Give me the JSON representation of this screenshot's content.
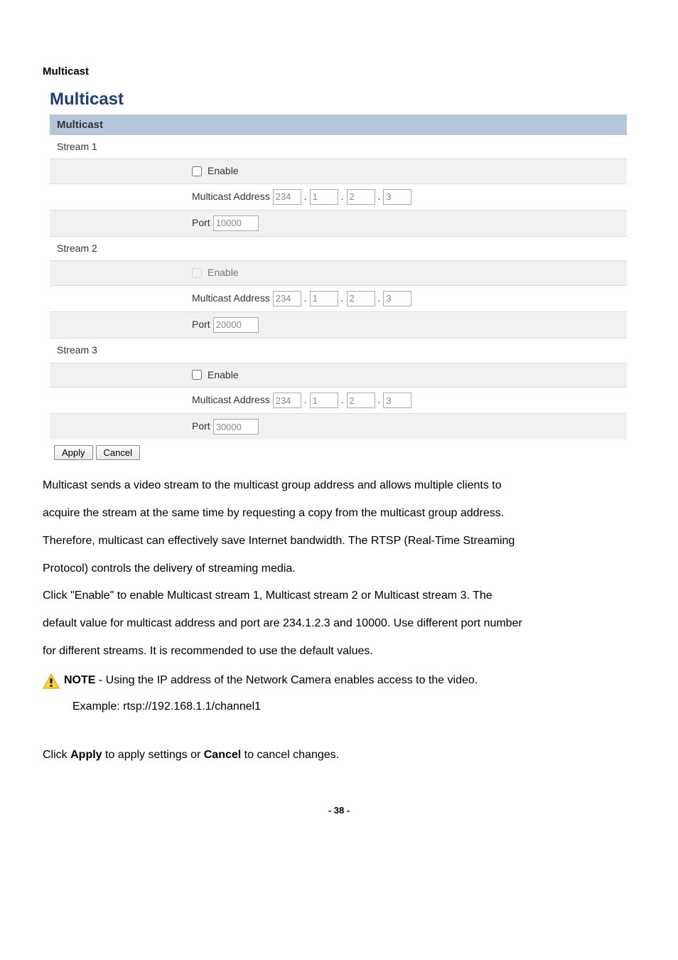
{
  "section_heading": "Multicast",
  "page_title": "Multicast",
  "panel_header": "Multicast",
  "streams": [
    {
      "label": "Stream 1",
      "enable_label": "Enable",
      "enable_checked": false,
      "enable_disabled": false,
      "addr_label": "Multicast Address",
      "addr": [
        "234",
        "1",
        "2",
        "3"
      ],
      "port_label": "Port",
      "port": "10000"
    },
    {
      "label": "Stream 2",
      "enable_label": "Enable",
      "enable_checked": false,
      "enable_disabled": true,
      "addr_label": "Multicast Address",
      "addr": [
        "234",
        "1",
        "2",
        "3"
      ],
      "port_label": "Port",
      "port": "20000"
    },
    {
      "label": "Stream 3",
      "enable_label": "Enable",
      "enable_checked": false,
      "enable_disabled": false,
      "addr_label": "Multicast Address",
      "addr": [
        "234",
        "1",
        "2",
        "3"
      ],
      "port_label": "Port",
      "port": "30000"
    }
  ],
  "buttons": {
    "apply": "Apply",
    "cancel": "Cancel"
  },
  "body": {
    "p1a": "Multicast sends a video stream to the multicast group address and allows multiple clients to",
    "p1b": "acquire the stream at the same time by requesting a copy from the multicast group address.",
    "p1c": "Therefore, multicast can effectively save Internet bandwidth. The RTSP (Real-Time Streaming",
    "p1d": "Protocol) controls the delivery of streaming media.",
    "p2a": "Click \"Enable\" to enable Multicast stream 1, Multicast stream 2 or Multicast stream 3. The",
    "p2b": "default value for multicast address and port are 234.1.2.3 and 10000. Use different port number",
    "p2c": "for different streams. It is recommended to use the default values.",
    "note_bold": "NOTE",
    "note_rest": " - Using the IP address of the Network Camera enables access to the video.",
    "example": "Example: rtsp://192.168.1.1/channel1",
    "closing_pre": "Click ",
    "closing_apply": "Apply",
    "closing_mid": " to apply settings or ",
    "closing_cancel": "Cancel",
    "closing_post": " to cancel changes."
  },
  "page_number": "- 38 -"
}
